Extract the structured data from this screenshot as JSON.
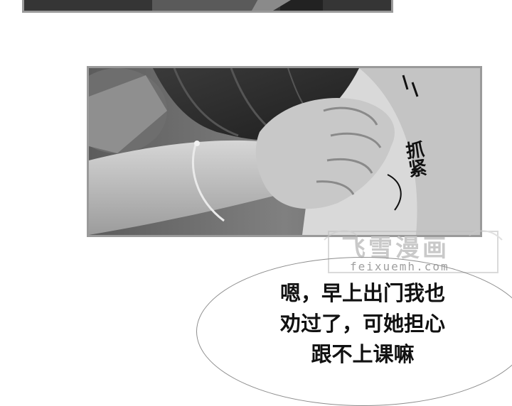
{
  "sfx": "抓紧",
  "watermark": {
    "title": "飞雪漫画",
    "url": "feixuemh.com"
  },
  "speech": {
    "lines": [
      "嗯，早上出门我也",
      "劝过了，可她担心",
      "跟不上课嘛"
    ]
  }
}
